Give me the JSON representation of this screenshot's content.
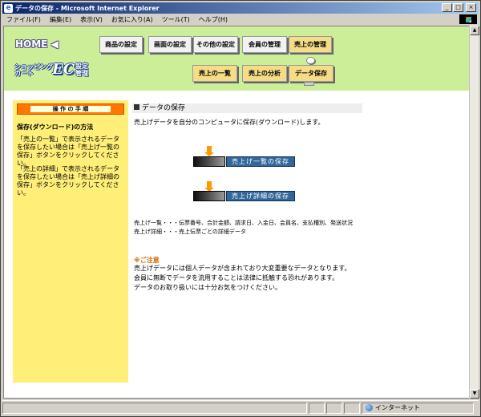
{
  "window": {
    "title": "データの保存 - Microsoft Internet Explorer",
    "minimize": "_",
    "maximize": "□",
    "close": "×"
  },
  "menu": [
    "ファイル(F)",
    "編集(E)",
    "表示(V)",
    "お気に入り(A)",
    "ツール(T)",
    "ヘルプ(H)"
  ],
  "header": {
    "home_label": "HOME ◀",
    "logo_shop": "ショッピング\nカート",
    "logo_ec": "EC",
    "logo_setting": "設定\n管理"
  },
  "nav_main": [
    {
      "label": "商品の設定"
    },
    {
      "label": "画面の設定"
    },
    {
      "label": "その他の設定"
    },
    {
      "label": "会員の管理"
    },
    {
      "label": "売上の管理"
    }
  ],
  "nav_sub": [
    {
      "label": "売上の一覧"
    },
    {
      "label": "売上の分析"
    },
    {
      "label": "データ保存"
    }
  ],
  "sidebar": {
    "title": "操 作 の 手 順",
    "heading": "保存(ダウンロード)の方法",
    "para1": "「売上の一覧」で表示されるデータを保存したい場合は「売上げ一覧の保存」ボタンをクリックしてください。",
    "para2": "「売上の詳細」で表示されるデータを保存したい場合は「売上げ詳細の保存」ボタンをクリックしてください。"
  },
  "main": {
    "section_title": "データの保存",
    "intro": "売上げデータを自分のコンピュータに保存(ダウンロード)します。",
    "btn_list": "売上げ一覧の保存",
    "btn_detail": "売上げ詳細の保存",
    "legend1": "売上げ一覧・・・伝票番号、合計金額、請求日、入金日、会員名、支払種別、発送状況",
    "legend2": "売上げ詳細・・・売上伝票ごとの詳細データ",
    "caution_title": "※ご注意",
    "caution1": "売上げデータには個人データが含まれており大変重要なデータとなります。",
    "caution2": "会員に無断でデータを流用することは法律に抵触する恐れがあります。",
    "caution3": "データのお取り扱いには十分お気をつけください。"
  },
  "status": {
    "zone": "インターネット"
  },
  "colors": {
    "header_bg": "#ccee99",
    "sidebar_bg": "#ffee77",
    "button_blue": "#336699",
    "accent_orange": "#ff7700"
  }
}
